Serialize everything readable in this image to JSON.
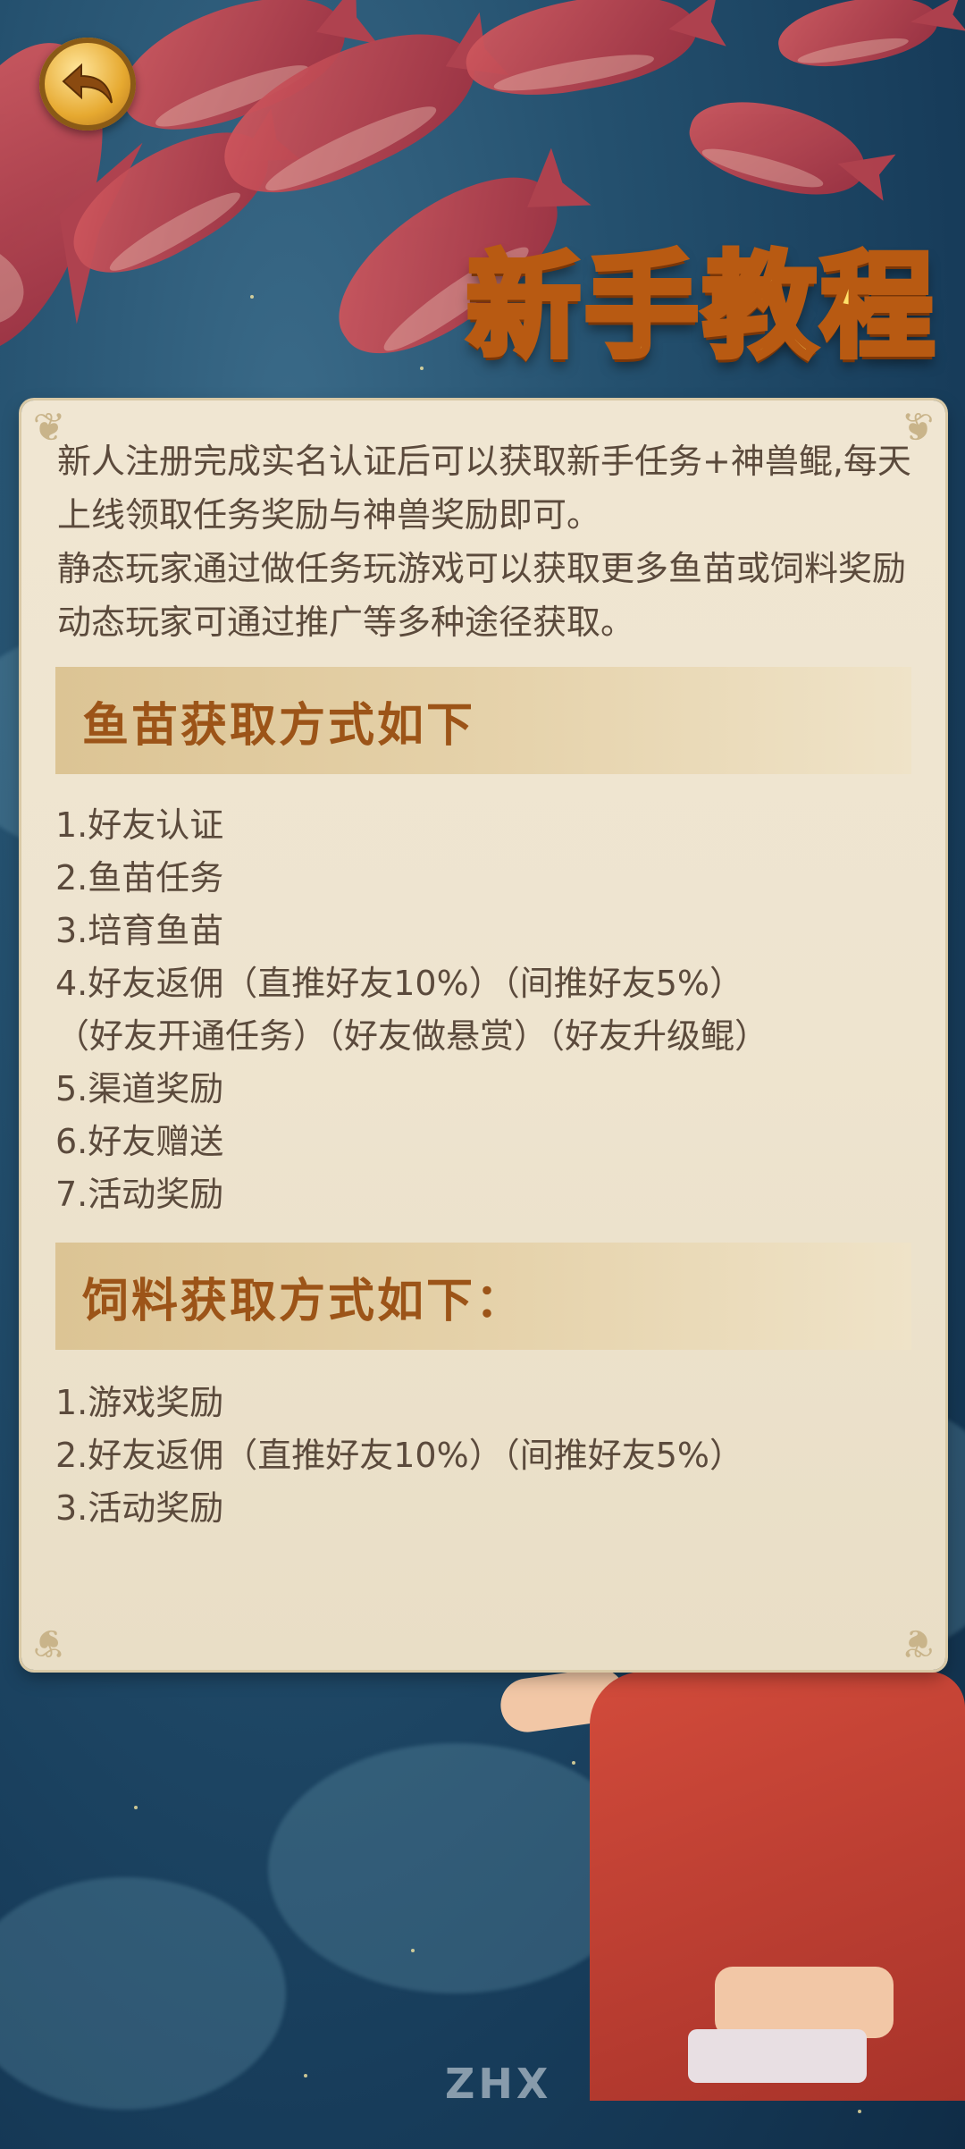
{
  "header": {
    "title": "新手教程",
    "back_icon": "back-arrow-icon"
  },
  "intro": {
    "paragraph1": "新人注册完成实名认证后可以获取新手任务+神兽鲲,每天上线领取任务奖励与神兽奖励即可。",
    "paragraph2": "静态玩家通过做任务玩游戏可以获取更多鱼苗或饲料奖励动态玩家可通过推广等多种途径获取。"
  },
  "fry_section": {
    "title": "鱼苗获取方式如下",
    "items": [
      "1.好友认证",
      "2.鱼苗任务",
      "3.培育鱼苗",
      "4.好友返佣（直推好友10%）（间推好友5%）",
      "（好友开通任务）（好友做悬赏）（好友升级鲲）",
      "5.渠道奖励",
      "6.好友赠送",
      "7.活动奖励"
    ]
  },
  "feed_section": {
    "title": "饲料获取方式如下：",
    "items": [
      "1.游戏奖励",
      "2.好友返佣（直推好友10%）（间推好友5%）",
      "3.活动奖励"
    ]
  },
  "watermark": "ZHX",
  "colors": {
    "title_gold": "#ffe26a",
    "section_text": "#9c5418",
    "body_text": "#5b4a3c",
    "panel_bg": "#eee4cf"
  }
}
